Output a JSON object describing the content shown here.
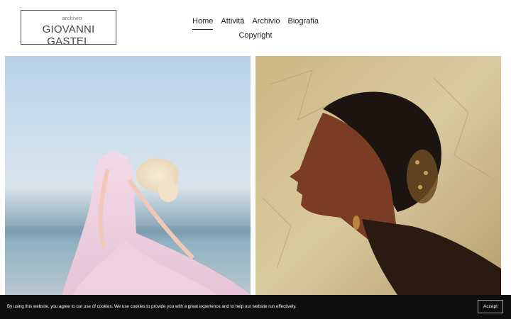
{
  "logo": {
    "small_text": "archivio",
    "name": "GIOVANNI GASTEL"
  },
  "nav": {
    "items": [
      {
        "label": "Home",
        "active": true
      },
      {
        "label": "Attività"
      },
      {
        "label": "Archivio"
      },
      {
        "label": "Biografia"
      },
      {
        "label": "Copyright"
      }
    ]
  },
  "gallery": {
    "images": [
      {
        "description": "woman-in-pink-dress-by-sea"
      },
      {
        "description": "woman-profile-gold-background"
      }
    ]
  },
  "cookie_banner": {
    "text": "By using this website, you agree to our use of cookies. We use cookies to provide you with a great experience and to help our website run effectively.",
    "accept_label": "Accept"
  },
  "colors": {
    "banner_bg": "#0d0d0d",
    "text": "#222222"
  }
}
